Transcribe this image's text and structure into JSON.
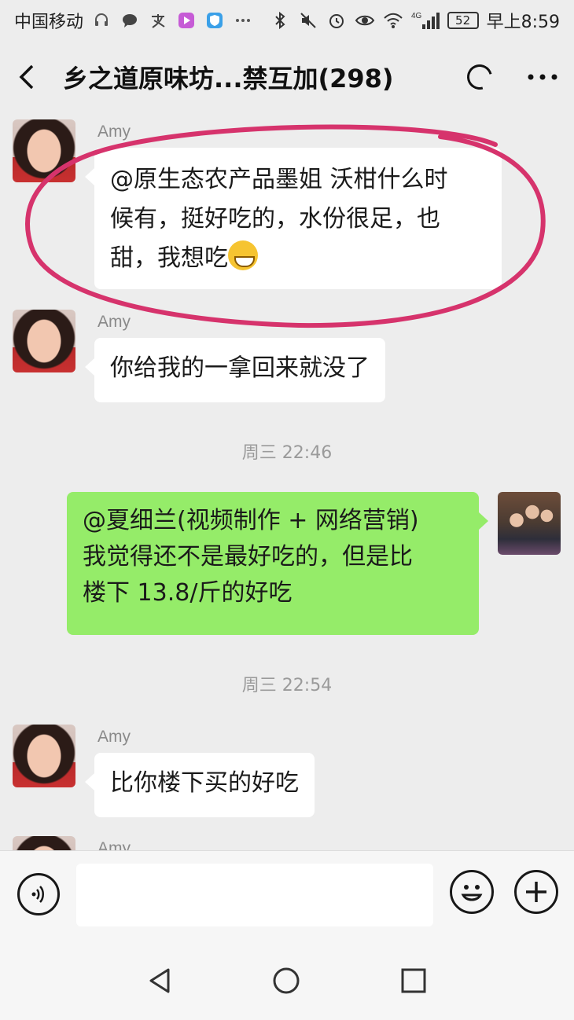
{
  "status_bar": {
    "carrier": "中国移动",
    "network": "4G",
    "battery": "52",
    "time": "早上8:59",
    "icons": [
      "headset-icon",
      "chat-bubble-icon",
      "alipay-icon",
      "video-app-icon",
      "shield-app-icon",
      "more-dots-icon",
      "bluetooth-icon",
      "mute-icon",
      "alarm-icon",
      "eye-icon",
      "wifi-icon",
      "signal-icon",
      "battery-icon"
    ]
  },
  "header": {
    "title": "乡之道原味坊...禁互加(298)"
  },
  "messages": [
    {
      "sender": "Amy",
      "text": "@原生态农产品墨姐  沃柑什么时候有，挺好吃的，水份很足，也甜，我想吃",
      "line1": "@原生态农产品墨姐  沃柑什么时",
      "line2": "候有，挺好吃的，水份很足，也",
      "line3": "甜，我想吃",
      "emoji": "grin-emoji"
    },
    {
      "sender": "Amy",
      "text": "你给我的一拿回来就没了"
    },
    {
      "timestamp": "周三 22:46"
    },
    {
      "sender": "me",
      "line1": "@夏细兰(视频制作 + 网络营销)",
      "line2": "我觉得还不是最好吃的，但是比",
      "line3": "楼下 13.8/斤的好吃"
    },
    {
      "timestamp": "周三 22:54"
    },
    {
      "sender": "Amy",
      "text": "比你楼下买的好吃"
    },
    {
      "sender": "Amy"
    }
  ],
  "colors": {
    "background": "#ededed",
    "incoming_bubble": "#ffffff",
    "outgoing_bubble": "#95ec69",
    "annotation_circle": "#d6336c"
  }
}
